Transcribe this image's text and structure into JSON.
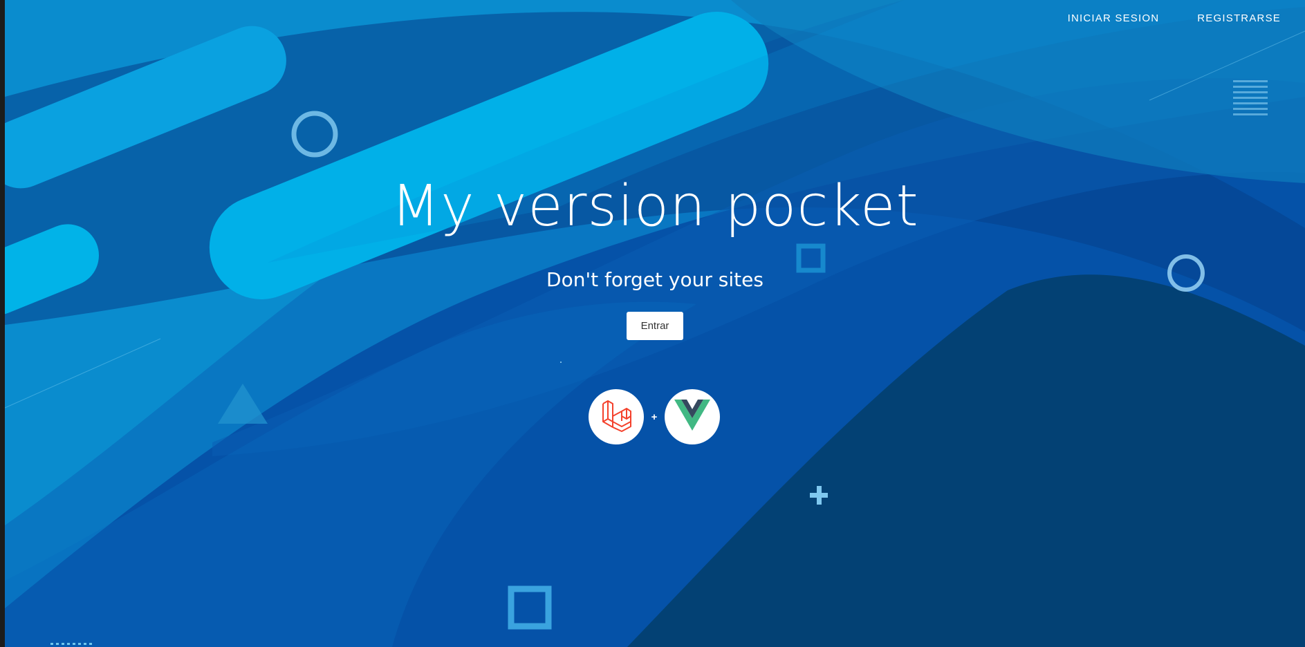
{
  "nav": {
    "login_label": "INICIAR SESION",
    "register_label": "REGISTRARSE"
  },
  "hero": {
    "title": "My version pocket",
    "subtitle": "Don't forget your sites",
    "enter_label": "Entrar",
    "separator": "+"
  },
  "icons": {
    "laravel": "laravel-logo-icon",
    "vue": "vue-logo-icon",
    "menu": "hamburger-menu-icon"
  },
  "colors": {
    "background": "#0552a8",
    "accent_light": "#00b4e8",
    "laravel_red": "#f4412c",
    "vue_green": "#41b883",
    "vue_dark": "#35495e"
  }
}
